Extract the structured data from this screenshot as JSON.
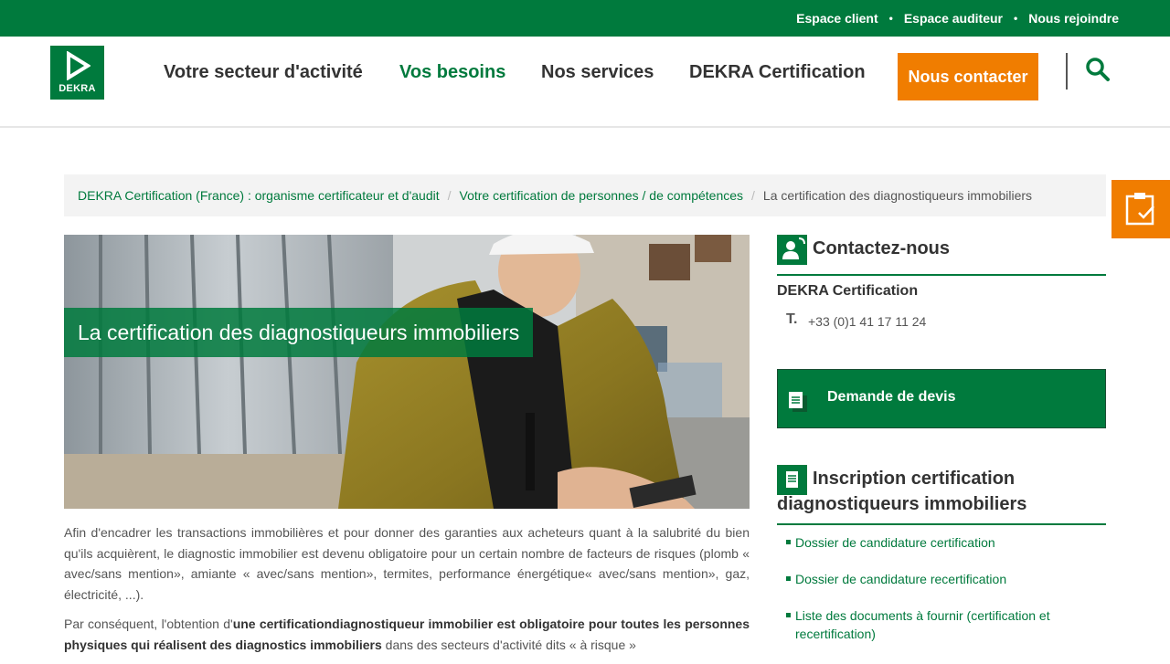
{
  "topbar": {
    "links": [
      "Espace client",
      "Espace auditeur",
      "Nous rejoindre"
    ],
    "separator": "•"
  },
  "header": {
    "logo_text": "DEKRA",
    "nav": [
      "Votre secteur d'activité",
      "Vos besoins",
      "Nos services",
      "DEKRA Certification"
    ],
    "active_nav": "Vos besoins",
    "contact_button": "Nous contacter",
    "search_icon": "search-icon"
  },
  "breadcrumb": {
    "items": [
      "DEKRA Certification (France) : organisme certificateur et d'audit",
      "Votre certification de personnes / de compétences"
    ],
    "separator": "/",
    "current": "La certification des diagnostiqueurs immobiliers"
  },
  "hero": {
    "title": "La certification des diagnostiqueurs immobiliers"
  },
  "article": {
    "p1": "Afin d'encadrer les transactions immobilières et pour donner des garanties aux acheteurs quant à la salubrité du bien qu'ils acquièrent, le diagnostic immobilier est devenu obligatoire pour un certain nombre de facteurs de risques (plomb « avec/sans mention», amiante « avec/sans mention», termites, performance énergétique« avec/sans mention», gaz, électricité, ...).",
    "p2_start": "Par conséquent, l'obtention d'",
    "p2_bold": "une certificationdiagnostiqueur immobilier est obligatoire pour toutes les personnes physiques qui réalisent des diagnostics immobiliers",
    "p2_end": " dans des secteurs d'activité dits « à risque »"
  },
  "sidebar": {
    "contact": {
      "title": "Contactez-nous",
      "icon": "contact-person-icon",
      "company": "DEKRA Certification",
      "phone_label": "T.",
      "phone": "+33 (0)1 41 17 11 24"
    },
    "quote_button": "Demande de devis",
    "inscription": {
      "title_line1": "Inscription certification",
      "title_line2": "diagnostiqueurs immobiliers",
      "links": [
        "Dossier de candidature certification",
        "Dossier de candidature recertification",
        "Liste des documents à fournir (certification et recertification)"
      ]
    }
  },
  "floating_tab": {
    "icon": "clipboard-check-icon"
  },
  "colors": {
    "brand_green": "#007a3d",
    "accent_orange": "#f07d00"
  }
}
